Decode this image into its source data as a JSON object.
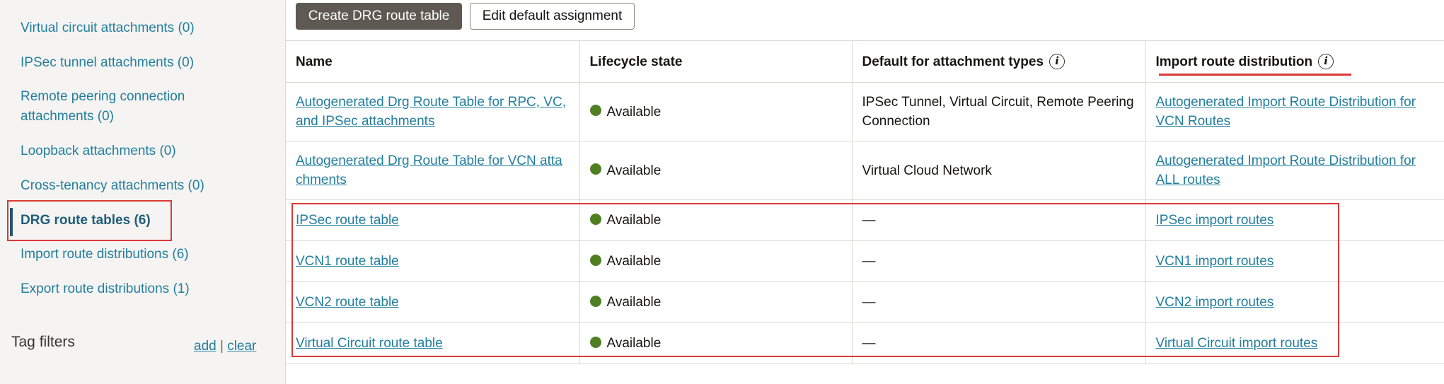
{
  "sidebar": {
    "items": [
      {
        "label": "Virtual circuit attachments (0)"
      },
      {
        "label": "IPSec tunnel attachments (0)"
      },
      {
        "label": "Remote peering connection attachments (0)",
        "line1": "Remote peering connection",
        "line2": "attachments (0)"
      },
      {
        "label": "Loopback attachments (0)"
      },
      {
        "label": "Cross-tenancy attachments (0)"
      },
      {
        "label": "DRG route tables (6)"
      },
      {
        "label": "Import route distributions (6)"
      },
      {
        "label": "Export route distributions (1)"
      }
    ],
    "tag_filters": {
      "title": "Tag filters",
      "add": "add",
      "separator": "|",
      "clear": "clear"
    }
  },
  "toolbar": {
    "create_label": "Create DRG route table",
    "edit_label": "Edit default assignment"
  },
  "table": {
    "headers": [
      "Name",
      "Lifecycle state",
      "Default for attachment types",
      "Import route distribution"
    ],
    "rows": [
      {
        "name": "Autogenerated Drg Route Table for RPC, VC, and IPSec attachments",
        "name_l1": "Autogenerated Drg Route Table for RPC, VC,",
        "name_l2": "and IPSec attachments",
        "state": "Available",
        "default_types": "IPSec Tunnel, Virtual Circuit, Remote Peering Connection",
        "types_l1": "IPSec Tunnel, Virtual Circuit, Remote Peering",
        "types_l2": "Connection",
        "import": "Autogenerated Import Route Distribution for VCN Routes",
        "import_l1": "Autogenerated Import Route Distribution for",
        "import_l2": "VCN Routes"
      },
      {
        "name": "Autogenerated Drg Route Table for VCN attachments",
        "name_l1": "Autogenerated Drg Route Table for VCN atta",
        "name_l2": "chments",
        "state": "Available",
        "default_types": "Virtual Cloud Network",
        "import": "Autogenerated Import Route Distribution for ALL routes",
        "import_l1": "Autogenerated Import Route Distribution for",
        "import_l2": "ALL routes"
      },
      {
        "name": "IPSec route table",
        "state": "Available",
        "default_types": "—",
        "import": "IPSec import routes"
      },
      {
        "name": "VCN1 route table",
        "state": "Available",
        "default_types": "—",
        "import": "VCN1 import routes"
      },
      {
        "name": "VCN2 route table",
        "state": "Available",
        "default_types": "—",
        "import": "VCN2 import routes"
      },
      {
        "name": "Virtual Circuit route table",
        "state": "Available",
        "default_types": "—",
        "import": "Virtual Circuit import routes"
      }
    ]
  },
  "colors": {
    "link": "#227e9e",
    "available_dot": "#4f7f22",
    "highlight": "#d93a36",
    "primary_button": "#5e5952"
  },
  "icons": [
    "info-icon",
    "status-dot-icon"
  ]
}
